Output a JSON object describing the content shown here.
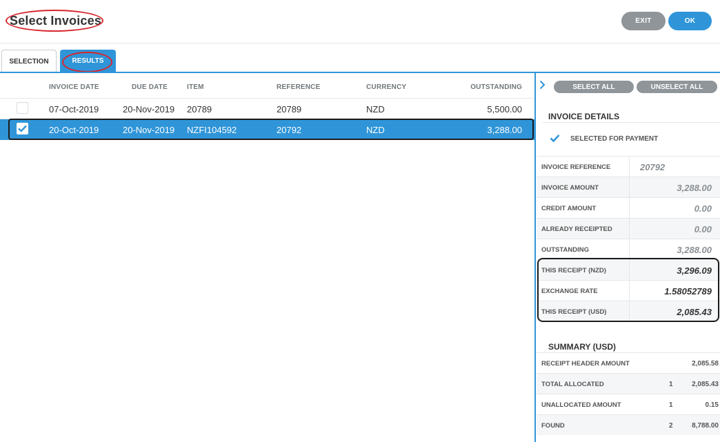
{
  "header": {
    "title": "Select Invoices",
    "exit_label": "EXIT",
    "ok_label": "OK"
  },
  "tabs": [
    {
      "label": "SELECTION"
    },
    {
      "label": "RESULTS"
    }
  ],
  "columns": [
    "INVOICE DATE",
    "DUE DATE",
    "ITEM",
    "REFERENCE",
    "CURRENCY",
    "OUTSTANDING"
  ],
  "rows": [
    {
      "selected": false,
      "invoice_date": "07-Oct-2019",
      "due_date": "20-Nov-2019",
      "item": "20789",
      "reference": "20789",
      "currency": "NZD",
      "outstanding": "5,500.00"
    },
    {
      "selected": true,
      "invoice_date": "20-Oct-2019",
      "due_date": "20-Nov-2019",
      "item": "NZFI104592",
      "reference": "20792",
      "currency": "NZD",
      "outstanding": "3,288.00"
    }
  ],
  "panel": {
    "select_all_label": "SELECT ALL",
    "unselect_all_label": "UNSELECT ALL",
    "details_title": "INVOICE DETAILS",
    "selected_for_payment_label": "SELECTED FOR PAYMENT",
    "details": [
      {
        "label": "INVOICE REFERENCE",
        "value": "20792"
      },
      {
        "label": "INVOICE AMOUNT",
        "value": "3,288.00"
      },
      {
        "label": "CREDIT AMOUNT",
        "value": "0.00"
      },
      {
        "label": "ALREADY RECEIPTED",
        "value": "0.00"
      },
      {
        "label": "OUTSTANDING",
        "value": "3,288.00"
      },
      {
        "label": "THIS RECEIPT (NZD)",
        "value": "3,296.09"
      },
      {
        "label": "EXCHANGE RATE",
        "value": "1.58052789"
      },
      {
        "label": "THIS RECEIPT (USD)",
        "value": "2,085.43"
      }
    ],
    "summary_title": "SUMMARY (USD)",
    "summary": [
      {
        "label": "RECEIPT HEADER AMOUNT",
        "count": "",
        "value": "2,085.58"
      },
      {
        "label": "TOTAL ALLOCATED",
        "count": "1",
        "value": "2,085.43"
      },
      {
        "label": "UNALLOCATED AMOUNT",
        "count": "1",
        "value": "0.15"
      },
      {
        "label": "FOUND",
        "count": "2",
        "value": "8,788.00"
      }
    ]
  },
  "colors": {
    "accent": "#2f95d8",
    "grey_button": "#8f9599",
    "annotation_red": "#d7262e"
  }
}
